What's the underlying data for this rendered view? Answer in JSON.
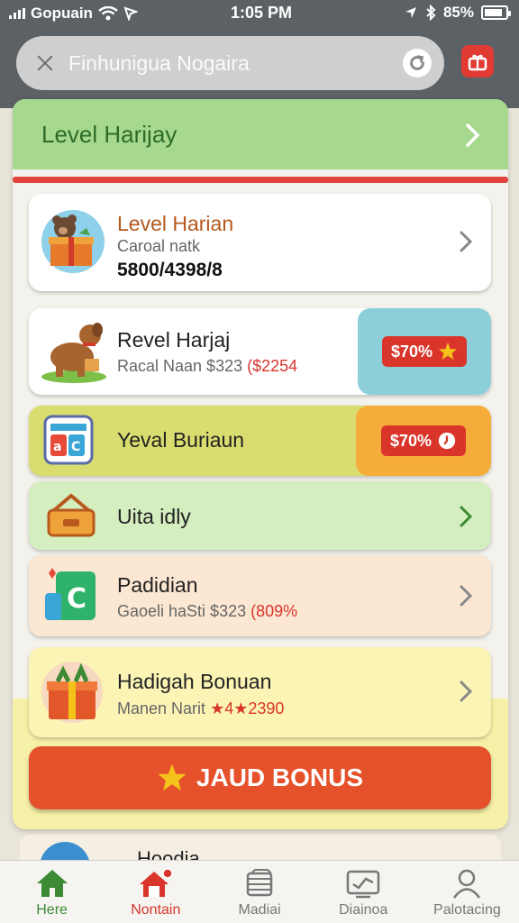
{
  "status_bar": {
    "carrier": "Gopuain",
    "time": "1:05 PM",
    "battery": "85%",
    "battery_level": 0.85
  },
  "search": {
    "placeholder": "Finhunigua Nogaira"
  },
  "header": {
    "title": "Level Harijay"
  },
  "cards": [
    {
      "title": "Level Harian",
      "subtitle": "Caroal natk",
      "value": "5800/4398/8",
      "icon": "bear-gift-icon"
    },
    {
      "title": "Revel Harjaj",
      "subtitle_prefix": "Racal Naan $323",
      "subtitle_highlight": "($2254",
      "badge": "$70%",
      "badge_icon": "star-icon",
      "icon": "dog-icon"
    },
    {
      "title": "Yeval Buriaun",
      "badge": "$70%",
      "badge_icon": "clock-icon",
      "icon": "abc-blocks-icon"
    },
    {
      "title": "Uita idly",
      "icon": "basket-icon"
    },
    {
      "title": "Padidian",
      "subtitle_prefix": "Gaoeli haSti $323",
      "subtitle_highlight": "(809%",
      "icon": "cash-icon"
    },
    {
      "title": "Hadigah Bonuan",
      "subtitle_prefix": "Manen Narit",
      "subtitle_highlight": "★4★2390",
      "icon": "gift-box-icon"
    }
  ],
  "bonus_button": {
    "label": "JAUD BONUS"
  },
  "peek": {
    "text": "Hoodia"
  },
  "tabs": [
    {
      "label": "Here",
      "icon": "home-icon"
    },
    {
      "label": "Nontain",
      "icon": "house-notification-icon"
    },
    {
      "label": "Madiai",
      "icon": "stack-icon"
    },
    {
      "label": "Diainoa",
      "icon": "chart-card-icon"
    },
    {
      "label": "Palotacing",
      "icon": "person-icon"
    }
  ],
  "colors": {
    "header_green": "#a6d98d",
    "accent_red": "#d9352b",
    "bonus_orange": "#e4512a",
    "tab_active": "#3d8a34"
  }
}
